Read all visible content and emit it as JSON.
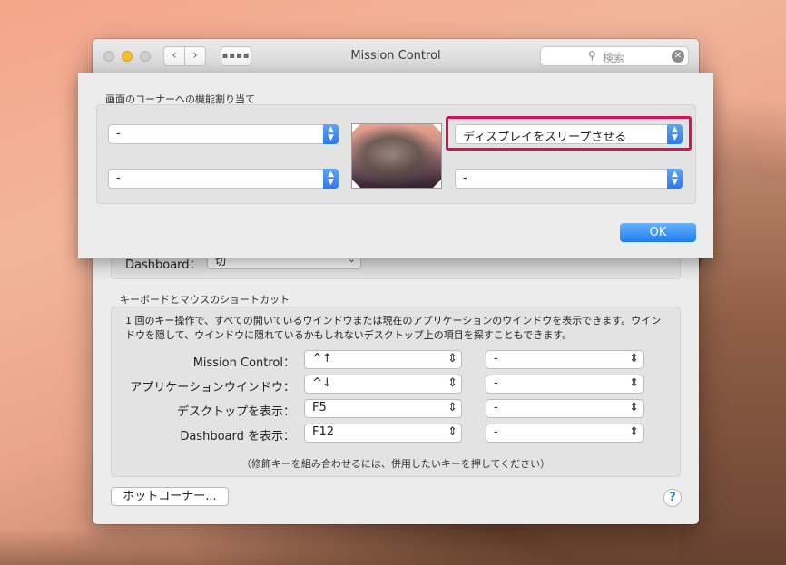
{
  "window": {
    "title": "Mission Control",
    "search_placeholder": "検索",
    "nav_back": "‹",
    "nav_forward": "›",
    "grid_glyph": "▪▪▪▪",
    "search_glyph": "⚲",
    "clear_glyph": "✕"
  },
  "dashboard": {
    "label": "Dashboard：",
    "value": "切"
  },
  "keyboard_section": {
    "title": "キーボードとマウスのショートカット",
    "description": "1 回のキー操作で、すべての開いているウインドウまたは現在のアプリケーションのウインドウを表示できます。ウインドウを隠して、ウインドウに隠れているかもしれないデスクトップ上の項目を探すこともできます。",
    "rows": [
      {
        "label": "Mission Control：",
        "keyboard": "^↑",
        "mouse": "-"
      },
      {
        "label": "アプリケーションウインドウ：",
        "keyboard": "^↓",
        "mouse": "-"
      },
      {
        "label": "デスクトップを表示：",
        "keyboard": "F5",
        "mouse": "-"
      },
      {
        "label": "Dashboard を表示：",
        "keyboard": "F12",
        "mouse": "-"
      }
    ],
    "note": "（修飾キーを組み合わせるには、併用したいキーを押してください）"
  },
  "hot_corners_button": "ホットコーナー...",
  "help_button": "?",
  "sheet": {
    "title": "画面のコーナーへの機能割り当て",
    "top_left": "-",
    "top_right": "ディスプレイをスリープさせる",
    "bottom_left": "-",
    "bottom_right": "-",
    "ok_label": "OK",
    "highlight_color": "#d5115a"
  }
}
